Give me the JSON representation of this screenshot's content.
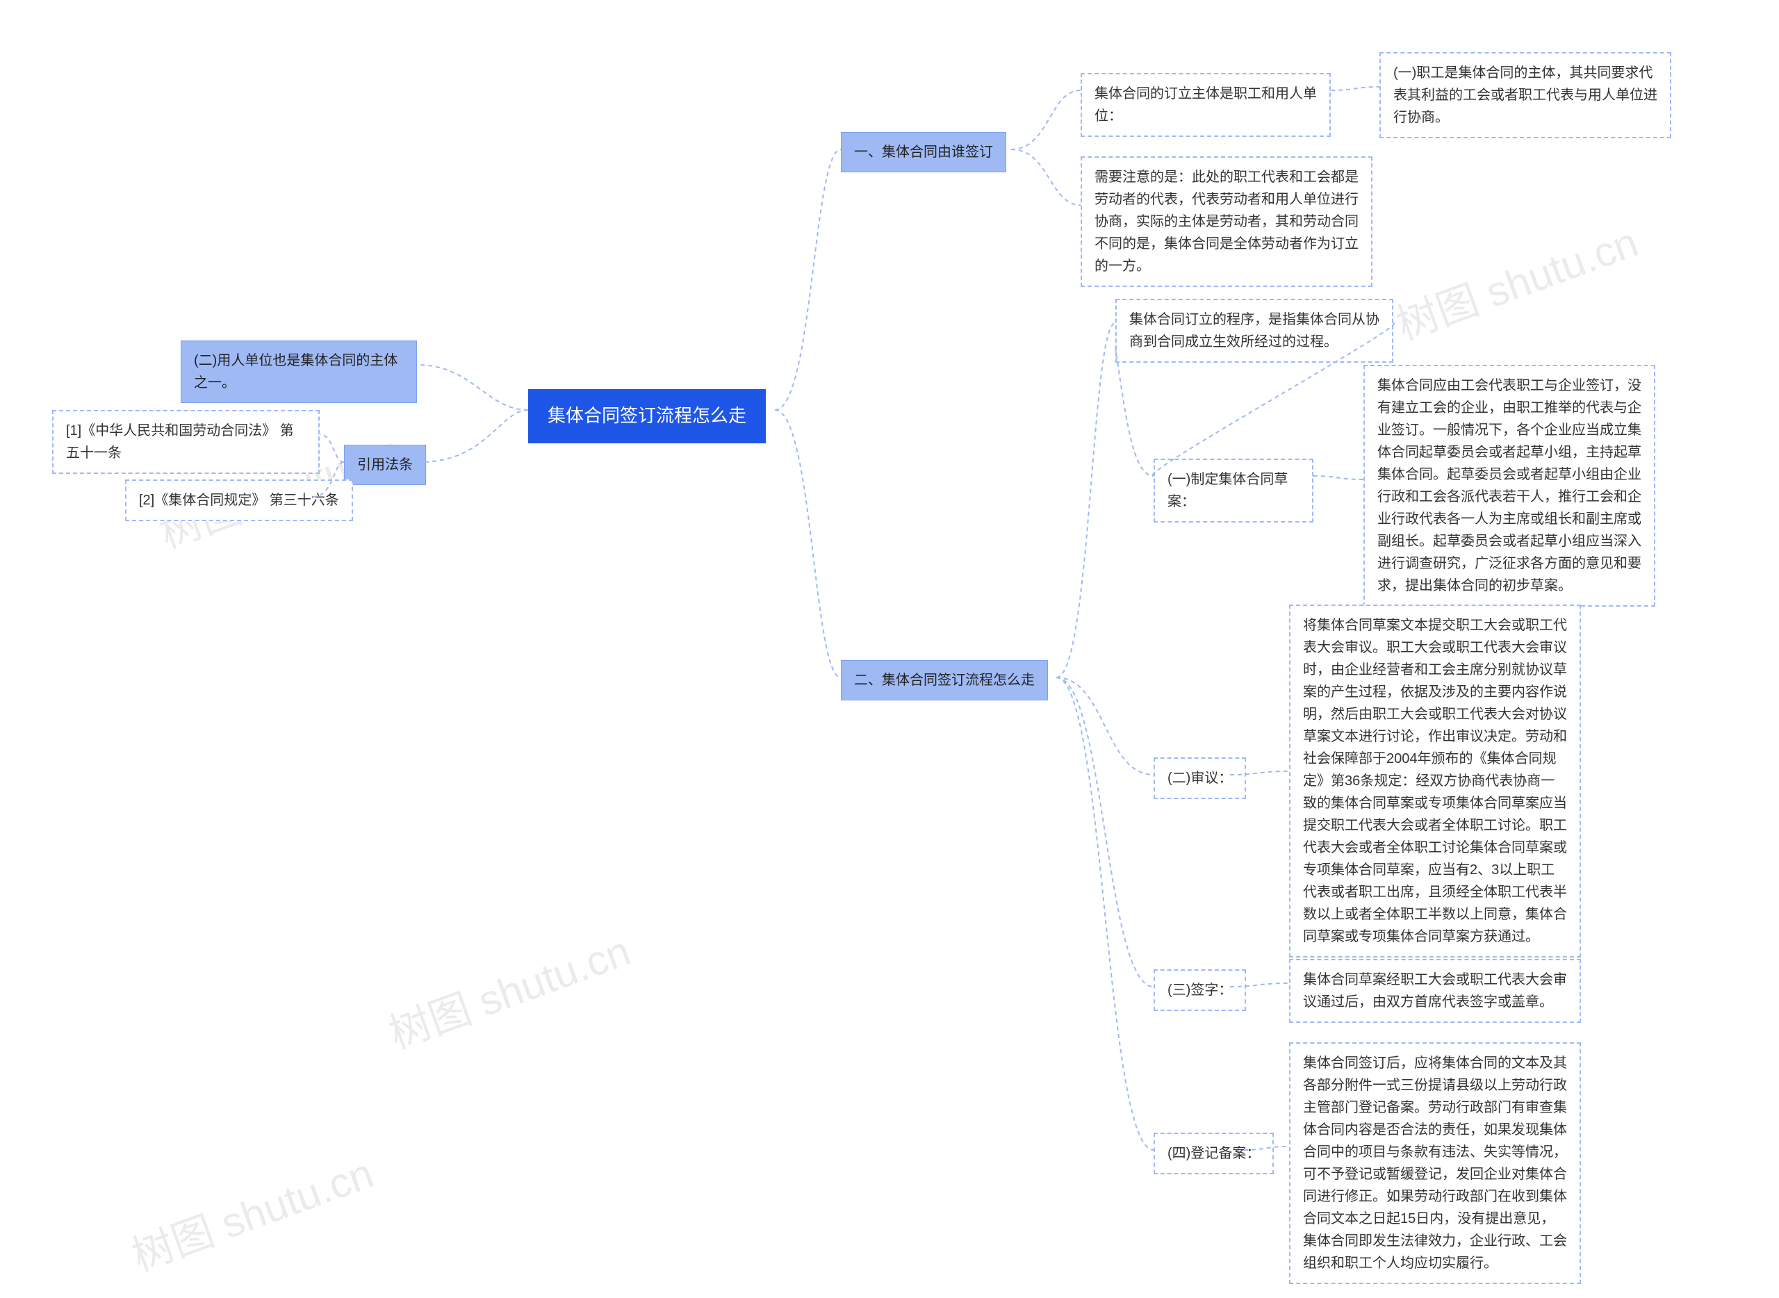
{
  "watermark": "树图 shutu.cn",
  "root": "集体合同签订流程怎么走",
  "left": {
    "node_employer": "(二)用人单位也是集体合同的主体之一。",
    "citation_label": "引用法条",
    "citation_1": "[1]《中华人民共和国劳动合同法》 第五十一条",
    "citation_2": "[2]《集体合同规定》 第三十六条"
  },
  "right": {
    "section1_title": "一、集体合同由谁签订",
    "s1_mainbody": "集体合同的订立主体是职工和用人单位：",
    "s1_mainbody_detail": "(一)职工是集体合同的主体，其共同要求代表其利益的工会或者职工代表与用人单位进行协商。",
    "s1_note": "需要注意的是：此处的职工代表和工会都是劳动者的代表，代表劳动者和用人单位进行协商，实际的主体是劳动者，其和劳动合同不同的是，集体合同是全体劳动者作为订立的一方。",
    "section2_title": "二、集体合同签订流程怎么走",
    "s2_intro": "集体合同订立的程序，是指集体合同从协商到合同成立生效所经过的过程。",
    "s2_step1_label": "(一)制定集体合同草案：",
    "s2_step1_text": "集体合同应由工会代表职工与企业签订，没有建立工会的企业，由职工推举的代表与企业签订。一般情况下，各个企业应当成立集体合同起草委员会或者起草小组，主持起草集体合同。起草委员会或者起草小组由企业行政和工会各派代表若干人，推行工会和企业行政代表各一人为主席或组长和副主席或副组长。起草委员会或者起草小组应当深入进行调查研究，广泛征求各方面的意见和要求，提出集体合同的初步草案。",
    "s2_step2_label": "(二)审议：",
    "s2_step2_text": "将集体合同草案文本提交职工大会或职工代表大会审议。职工大会或职工代表大会审议时，由企业经营者和工会主席分别就协议草案的产生过程，依据及涉及的主要内容作说明，然后由职工大会或职工代表大会对协议草案文本进行讨论，作出审议决定。劳动和社会保障部于2004年颁布的《集体合同规定》第36条规定：经双方协商代表协商一致的集体合同草案或专项集体合同草案应当提交职工代表大会或者全体职工讨论。职工代表大会或者全体职工讨论集体合同草案或专项集体合同草案，应当有2、3以上职工代表或者职工出席，且须经全体职工代表半数以上或者全体职工半数以上同意，集体合同草案或专项集体合同草案方获通过。",
    "s2_step3_label": "(三)签字：",
    "s2_step3_text": "集体合同草案经职工大会或职工代表大会审议通过后，由双方首席代表签字或盖章。",
    "s2_step4_label": "(四)登记备案：",
    "s2_step4_text": "集体合同签订后，应将集体合同的文本及其各部分附件一式三份提请县级以上劳动行政主管部门登记备案。劳动行政部门有审查集体合同内容是否合法的责任，如果发现集体合同中的项目与条款有违法、失实等情况，可不予登记或暂缓登记，发回企业对集体合同进行修正。如果劳动行政部门在收到集体合同文本之日起15日内，没有提出意见，集体合同即发生法律效力，企业行政、工会组织和职工个人均应切实履行。"
  },
  "chart_data": {
    "type": "table",
    "title": "集体合同签订流程怎么走",
    "structure": "mindmap",
    "central_topic": "集体合同签订流程怎么走",
    "left_branches": [
      {
        "label": "(二)用人单位也是集体合同的主体之一。"
      },
      {
        "label": "引用法条",
        "children": [
          "[1]《中华人民共和国劳动合同法》 第五十一条",
          "[2]《集体合同规定》 第三十六条"
        ]
      }
    ],
    "right_branches": [
      {
        "label": "一、集体合同由谁签订",
        "children": [
          {
            "label": "集体合同的订立主体是职工和用人单位：",
            "children": [
              "(一)职工是集体合同的主体，其共同要求代表其利益的工会或者职工代表与用人单位进行协商。"
            ]
          },
          "需要注意的是：此处的职工代表和工会都是劳动者的代表，代表劳动者和用人单位进行协商，实际的主体是劳动者，其和劳动合同不同的是，集体合同是全体劳动者作为订立的一方。"
        ]
      },
      {
        "label": "二、集体合同签订流程怎么走",
        "children": [
          {
            "label": "集体合同订立的程序，是指集体合同从协商到合同成立生效所经过的过程。",
            "children": [
              {
                "label": "(一)制定集体合同草案：",
                "text": "集体合同应由工会代表职工与企业签订，没有建立工会的企业，由职工推举的代表与企业签订。一般情况下，各个企业应当成立集体合同起草委员会或者起草小组，主持起草集体合同。起草委员会或者起草小组由企业行政和工会各派代表若干人，推行工会和企业行政代表各一人为主席或组长和副主席或副组长。起草委员会或者起草小组应当深入进行调查研究，广泛征求各方面的意见和要求，提出集体合同的初步草案。"
              }
            ]
          },
          {
            "label": "(二)审议：",
            "text": "将集体合同草案文本提交职工大会或职工代表大会审议。职工大会或职工代表大会审议时，由企业经营者和工会主席分别就协议草案的产生过程，依据及涉及的主要内容作说明，然后由职工大会或职工代表大会对协议草案文本进行讨论，作出审议决定。劳动和社会保障部于2004年颁布的《集体合同规定》第36条规定：经双方协商代表协商一致的集体合同草案或专项集体合同草案应当提交职工代表大会或者全体职工讨论。职工代表大会或者全体职工讨论集体合同草案或专项集体合同草案，应当有2、3以上职工代表或者职工出席，且须经全体职工代表半数以上或者全体职工半数以上同意，集体合同草案或专项集体合同草案方获通过。"
          },
          {
            "label": "(三)签字：",
            "text": "集体合同草案经职工大会或职工代表大会审议通过后，由双方首席代表签字或盖章。"
          },
          {
            "label": "(四)登记备案：",
            "text": "集体合同签订后，应将集体合同的文本及其各部分附件一式三份提请县级以上劳动行政主管部门登记备案。劳动行政部门有审查集体合同内容是否合法的责任，如果发现集体合同中的项目与条款有违法、失实等情况，可不予登记或暂缓登记，发回企业对集体合同进行修正。如果劳动行政部门在收到集体合同文本之日起15日内，没有提出意见，集体合同即发生法律效力，企业行政、工会组织和职工个人均应切实履行。"
          }
        ]
      }
    ]
  }
}
